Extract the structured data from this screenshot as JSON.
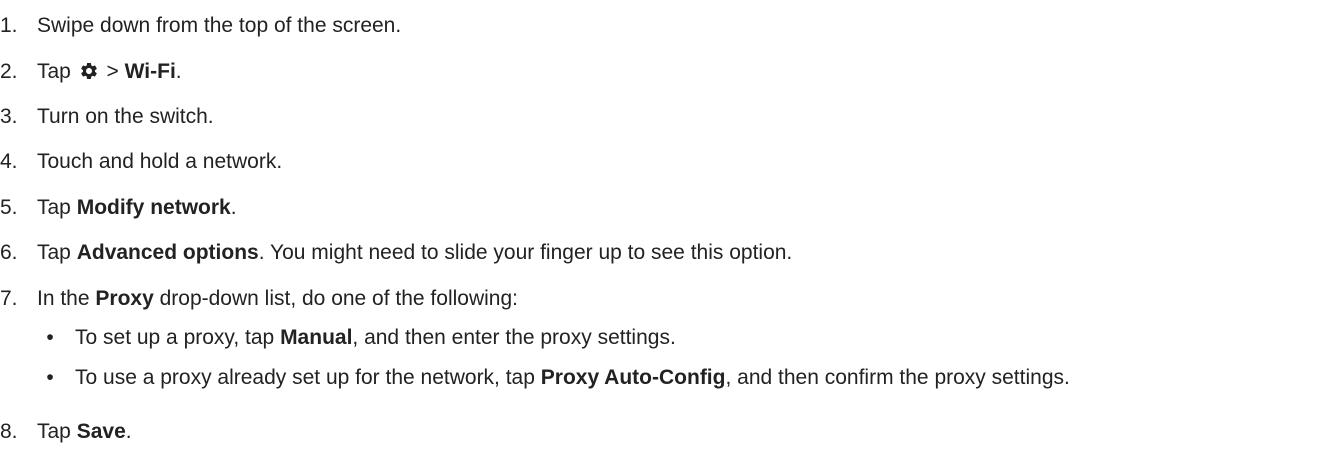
{
  "steps": [
    {
      "num": "1.",
      "parts": [
        {
          "t": "Swipe down from the top of the screen.",
          "b": false
        }
      ]
    },
    {
      "num": "2.",
      "pre": "Tap",
      "sep": ">",
      "bold": "Wi-Fi",
      "post": ".",
      "icon": "settings-gear-icon"
    },
    {
      "num": "3.",
      "parts": [
        {
          "t": "Turn on the switch.",
          "b": false
        }
      ]
    },
    {
      "num": "4.",
      "parts": [
        {
          "t": "Touch and hold a network.",
          "b": false
        }
      ]
    },
    {
      "num": "5.",
      "parts": [
        {
          "t": "Tap ",
          "b": false
        },
        {
          "t": "Modify network",
          "b": true
        },
        {
          "t": ".",
          "b": false
        }
      ]
    },
    {
      "num": "6.",
      "parts": [
        {
          "t": "Tap ",
          "b": false
        },
        {
          "t": "Advanced options",
          "b": true
        },
        {
          "t": ". You might need to slide your finger up to see this option.",
          "b": false
        }
      ]
    },
    {
      "num": "7.",
      "parts": [
        {
          "t": "In the ",
          "b": false
        },
        {
          "t": "Proxy",
          "b": true
        },
        {
          "t": " drop-down list, do one of the following:",
          "b": false
        }
      ]
    },
    {
      "num": "8.",
      "parts": [
        {
          "t": "Tap ",
          "b": false
        },
        {
          "t": "Save",
          "b": true
        },
        {
          "t": ".",
          "b": false
        }
      ]
    }
  ],
  "sub_bullets": [
    {
      "bullet": "•",
      "parts": [
        {
          "t": "To set up a proxy, tap ",
          "b": false
        },
        {
          "t": "Manual",
          "b": true
        },
        {
          "t": ", and then enter the proxy settings.",
          "b": false
        }
      ]
    },
    {
      "bullet": "•",
      "parts": [
        {
          "t": "To use a proxy already set up for the network, tap ",
          "b": false
        },
        {
          "t": "Proxy Auto-Config",
          "b": true
        },
        {
          "t": ", and then confirm the proxy settings.",
          "b": false
        }
      ]
    }
  ]
}
